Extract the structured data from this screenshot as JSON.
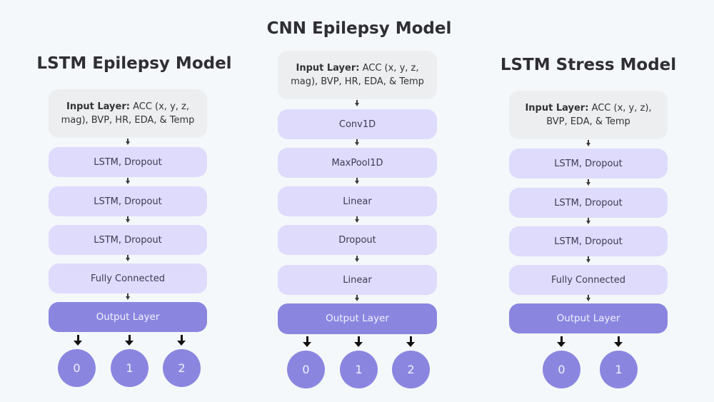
{
  "colors": {
    "background": "#f5f8fa",
    "input_layer": "#eceef0",
    "hidden_layer": "#dedbfc",
    "output_layer": "#8a86e0",
    "title_text": "#2f2f33"
  },
  "models": [
    {
      "title": "LSTM Epilepsy Model",
      "input": {
        "label": "Input Layer:",
        "line1": "ACC (x, y, z,",
        "line2": "mag), BVP, HR, EDA, & Temp"
      },
      "layers": [
        "LSTM, Dropout",
        "LSTM, Dropout",
        "LSTM, Dropout",
        "Fully Connected"
      ],
      "output": "Output Layer",
      "classes": [
        "0",
        "1",
        "2"
      ]
    },
    {
      "title": "CNN Epilepsy Model",
      "input": {
        "label": "Input Layer:",
        "line1": "ACC (x, y, z,",
        "line2": "mag), BVP, HR, EDA, & Temp"
      },
      "layers": [
        "Conv1D",
        "MaxPool1D",
        "Linear",
        "Dropout",
        "Linear"
      ],
      "output": "Output Layer",
      "classes": [
        "0",
        "1",
        "2"
      ]
    },
    {
      "title": "LSTM Stress Model",
      "input": {
        "label": "Input Layer:",
        "line1": "ACC (x, y, z),",
        "line2": "BVP, EDA, & Temp"
      },
      "layers": [
        "LSTM, Dropout",
        "LSTM, Dropout",
        "LSTM, Dropout",
        "Fully Connected"
      ],
      "output": "Output Layer",
      "classes": [
        "0",
        "1"
      ]
    }
  ]
}
